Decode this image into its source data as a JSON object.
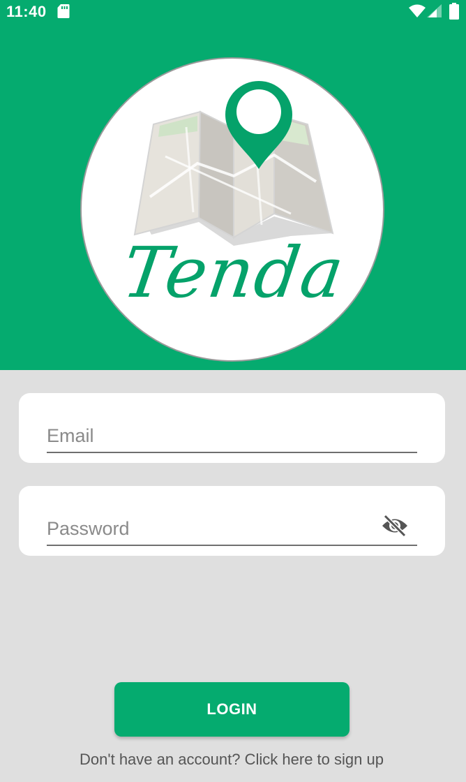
{
  "status_bar": {
    "time": "11:40",
    "icons": [
      "sd-card-icon",
      "wifi-icon",
      "cell-signal-icon",
      "battery-icon"
    ]
  },
  "logo": {
    "text": "Tenda",
    "icons": [
      "folded-map-icon",
      "location-pin-icon"
    ]
  },
  "form": {
    "email_placeholder": "Email",
    "email_value": "",
    "password_placeholder": "Password",
    "password_value": "",
    "visibility_icon": "eye-off-icon"
  },
  "actions": {
    "login_label": "LOGIN",
    "signup_text": "Don't have an account? Click here to sign up"
  },
  "colors": {
    "brand_green": "#05ab6f",
    "background": "#dfdfdf",
    "card": "#ffffff"
  }
}
